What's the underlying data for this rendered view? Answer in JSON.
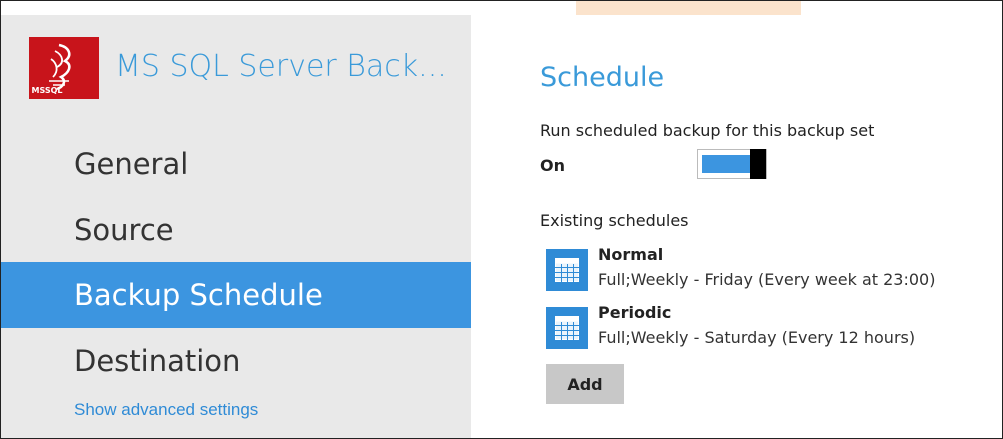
{
  "app": {
    "title": "MS SQL Server Back...",
    "logo_tag": "MSSQL",
    "logo_color": "#c8141b",
    "accent": "#3c95e0"
  },
  "sidebar": {
    "items": [
      {
        "label": "General",
        "active": false
      },
      {
        "label": "Source",
        "active": false
      },
      {
        "label": "Backup Schedule",
        "active": true
      },
      {
        "label": "Destination",
        "active": false
      }
    ],
    "advanced_link": "Show advanced settings"
  },
  "main": {
    "title": "Schedule",
    "run_label": "Run scheduled backup for this backup set",
    "toggle_state": "On",
    "existing_label": "Existing schedules",
    "schedules": [
      {
        "name": "Normal",
        "desc": "Full;Weekly - Friday (Every week at 23:00)",
        "icon": "calendar-icon"
      },
      {
        "name": "Periodic",
        "desc": "Full;Weekly - Saturday (Every 12 hours)",
        "icon": "calendar-icon"
      }
    ],
    "add_label": "Add"
  }
}
